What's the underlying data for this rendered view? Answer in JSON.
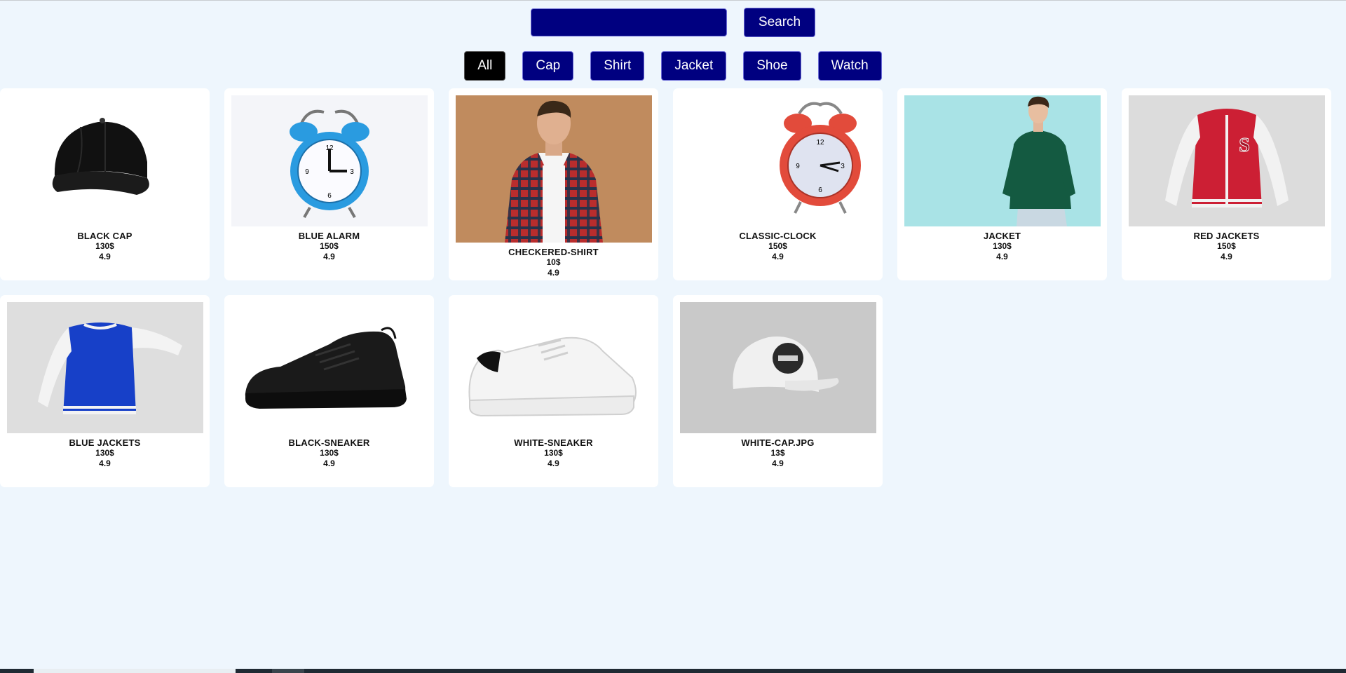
{
  "search": {
    "value": "",
    "placeholder": "",
    "button_label": "Search"
  },
  "filters": [
    "All",
    "Cap",
    "Shirt",
    "Jacket",
    "Shoe",
    "Watch"
  ],
  "active_filter": "All",
  "products": [
    {
      "name": "BLACK CAP",
      "price": "130$",
      "rating": "4.9",
      "image": "black-cap"
    },
    {
      "name": "BLUE ALARM",
      "price": "150$",
      "rating": "4.9",
      "image": "blue-alarm-clock"
    },
    {
      "name": "CHECKERED-SHIRT",
      "price": "10$",
      "rating": "4.9",
      "image": "checkered-shirt-man"
    },
    {
      "name": "CLASSIC-CLOCK",
      "price": "150$",
      "rating": "4.9",
      "image": "red-alarm-clock"
    },
    {
      "name": "JACKET",
      "price": "130$",
      "rating": "4.9",
      "image": "green-sweater-man"
    },
    {
      "name": "RED JACKETS",
      "price": "150$",
      "rating": "4.9",
      "image": "red-varsity-jacket"
    },
    {
      "name": "BLUE JACKETS",
      "price": "130$",
      "rating": "4.9",
      "image": "blue-varsity-jacket"
    },
    {
      "name": "BLACK-SNEAKER",
      "price": "130$",
      "rating": "4.9",
      "image": "black-sneaker"
    },
    {
      "name": "WHITE-SNEAKER",
      "price": "130$",
      "rating": "4.9",
      "image": "white-sneaker"
    },
    {
      "name": "WHITE-CAP.JPG",
      "price": "13$",
      "rating": "4.9",
      "image": "white-cap"
    }
  ],
  "colors": {
    "background": "#eef6fd",
    "accent": "#000080",
    "active": "#000000"
  }
}
